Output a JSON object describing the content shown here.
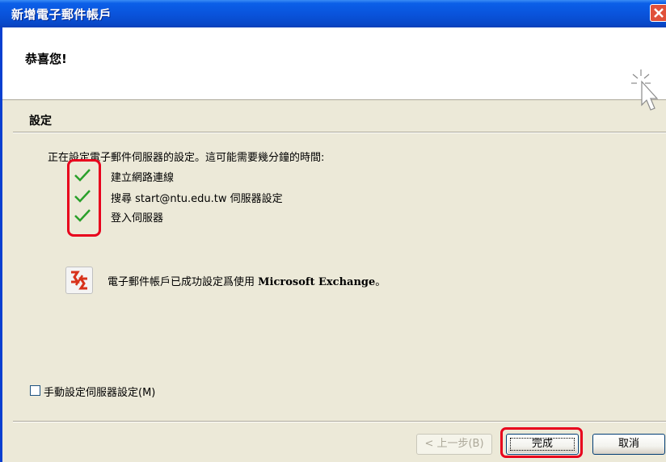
{
  "window": {
    "title": "新增電子郵件帳戶"
  },
  "header": {
    "title": "恭喜您!"
  },
  "section": {
    "title": "設定"
  },
  "progress": {
    "intro": "正在設定電子郵件伺服器的設定。這可能需要幾分鐘的時間:",
    "steps": [
      {
        "label": "建立網路連線",
        "status": "done"
      },
      {
        "label": "搜尋 start@ntu.edu.tw 伺服器設定",
        "status": "done"
      },
      {
        "label": "登入伺服器",
        "status": "done"
      }
    ]
  },
  "result": {
    "text_prefix": "電子郵件帳戶已成功設定爲使用 ",
    "text_bold": "Microsoft Exchange",
    "text_suffix": "。",
    "icon": "exchange-icon"
  },
  "manual": {
    "label": "手動設定伺服器設定(M)",
    "checked": false
  },
  "buttons": {
    "back": "< 上一步(B)",
    "finish": "完成",
    "cancel": "取消"
  },
  "colors": {
    "titlebar": "#0a54dc",
    "check": "#2aa02a",
    "highlight": "#e8001c",
    "dialog_bg": "#ece9d8"
  }
}
